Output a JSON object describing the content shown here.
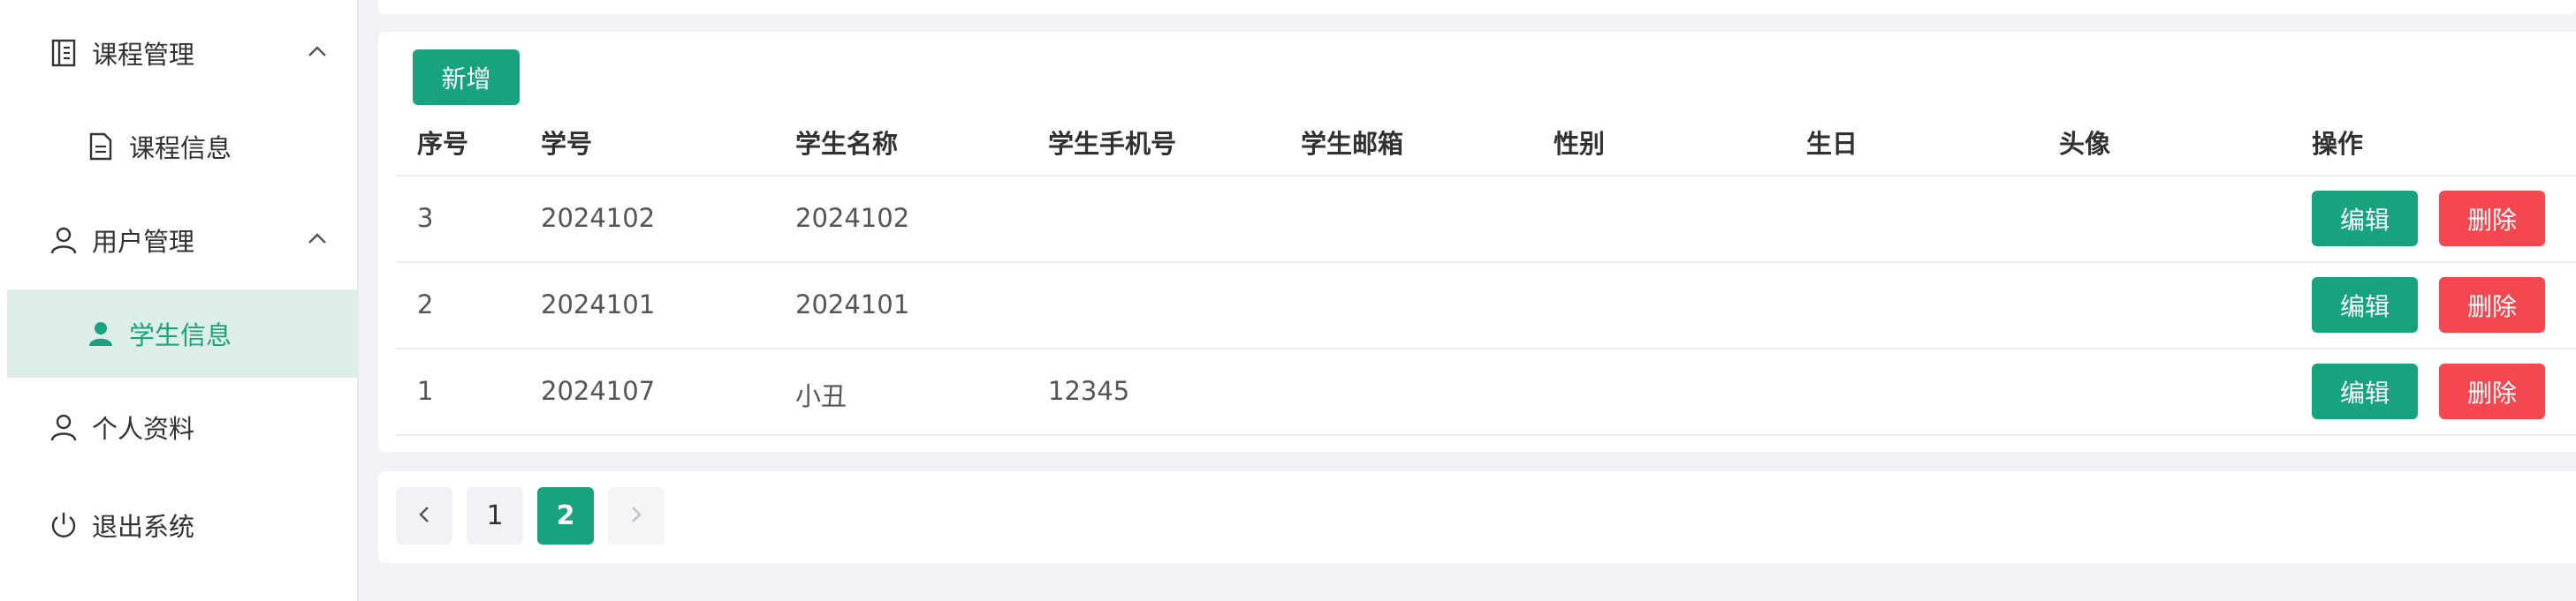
{
  "sidebar": {
    "course_mgmt": "课程管理",
    "course_info": "课程信息",
    "user_mgmt": "用户管理",
    "student_info": "学生信息",
    "profile": "个人资料",
    "logout": "退出系统"
  },
  "toolbar": {
    "add_label": "新增"
  },
  "table": {
    "headers": [
      "序号",
      "学号",
      "学生名称",
      "学生手机号",
      "学生邮箱",
      "性别",
      "生日",
      "头像",
      "操作"
    ],
    "rows": [
      [
        "3",
        "2024102",
        "2024102",
        "",
        "",
        "",
        "",
        ""
      ],
      [
        "2",
        "2024101",
        "2024101",
        "",
        "",
        "",
        "",
        ""
      ],
      [
        "1",
        "2024107",
        "小丑",
        "12345",
        "",
        "",
        "",
        ""
      ]
    ],
    "edit_label": "编辑",
    "delete_label": "删除"
  },
  "pagination": {
    "pages": [
      "1",
      "2"
    ],
    "current": "2"
  },
  "colors": {
    "accent": "#16a37e",
    "danger": "#f4474f",
    "active_bg": "#ddeee9"
  }
}
